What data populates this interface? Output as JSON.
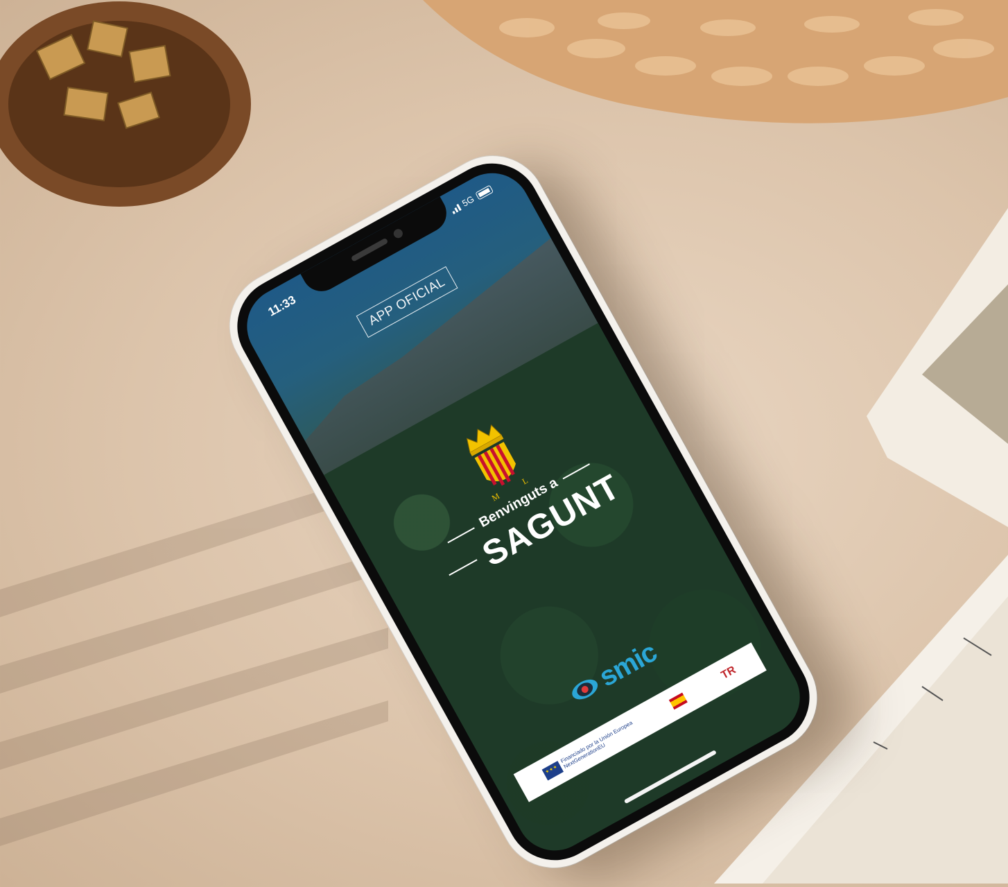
{
  "status_bar": {
    "time": "11:33",
    "network": "5G"
  },
  "header": {
    "badge": "APP OFICIAL"
  },
  "welcome": {
    "greeting": "Benvinguts a",
    "city": "SAGUNT",
    "crest_letters": [
      "M",
      "L"
    ]
  },
  "logos": {
    "partner": "smic",
    "funding_eu": "Financiado por la Unión Europea",
    "funding_eu_sub": "NextGenerationEU",
    "funding_es_mark": "TR"
  },
  "colors": {
    "accent_blue": "#2ba6d6",
    "crest_red": "#c8102e",
    "crest_gold": "#f2c200"
  }
}
